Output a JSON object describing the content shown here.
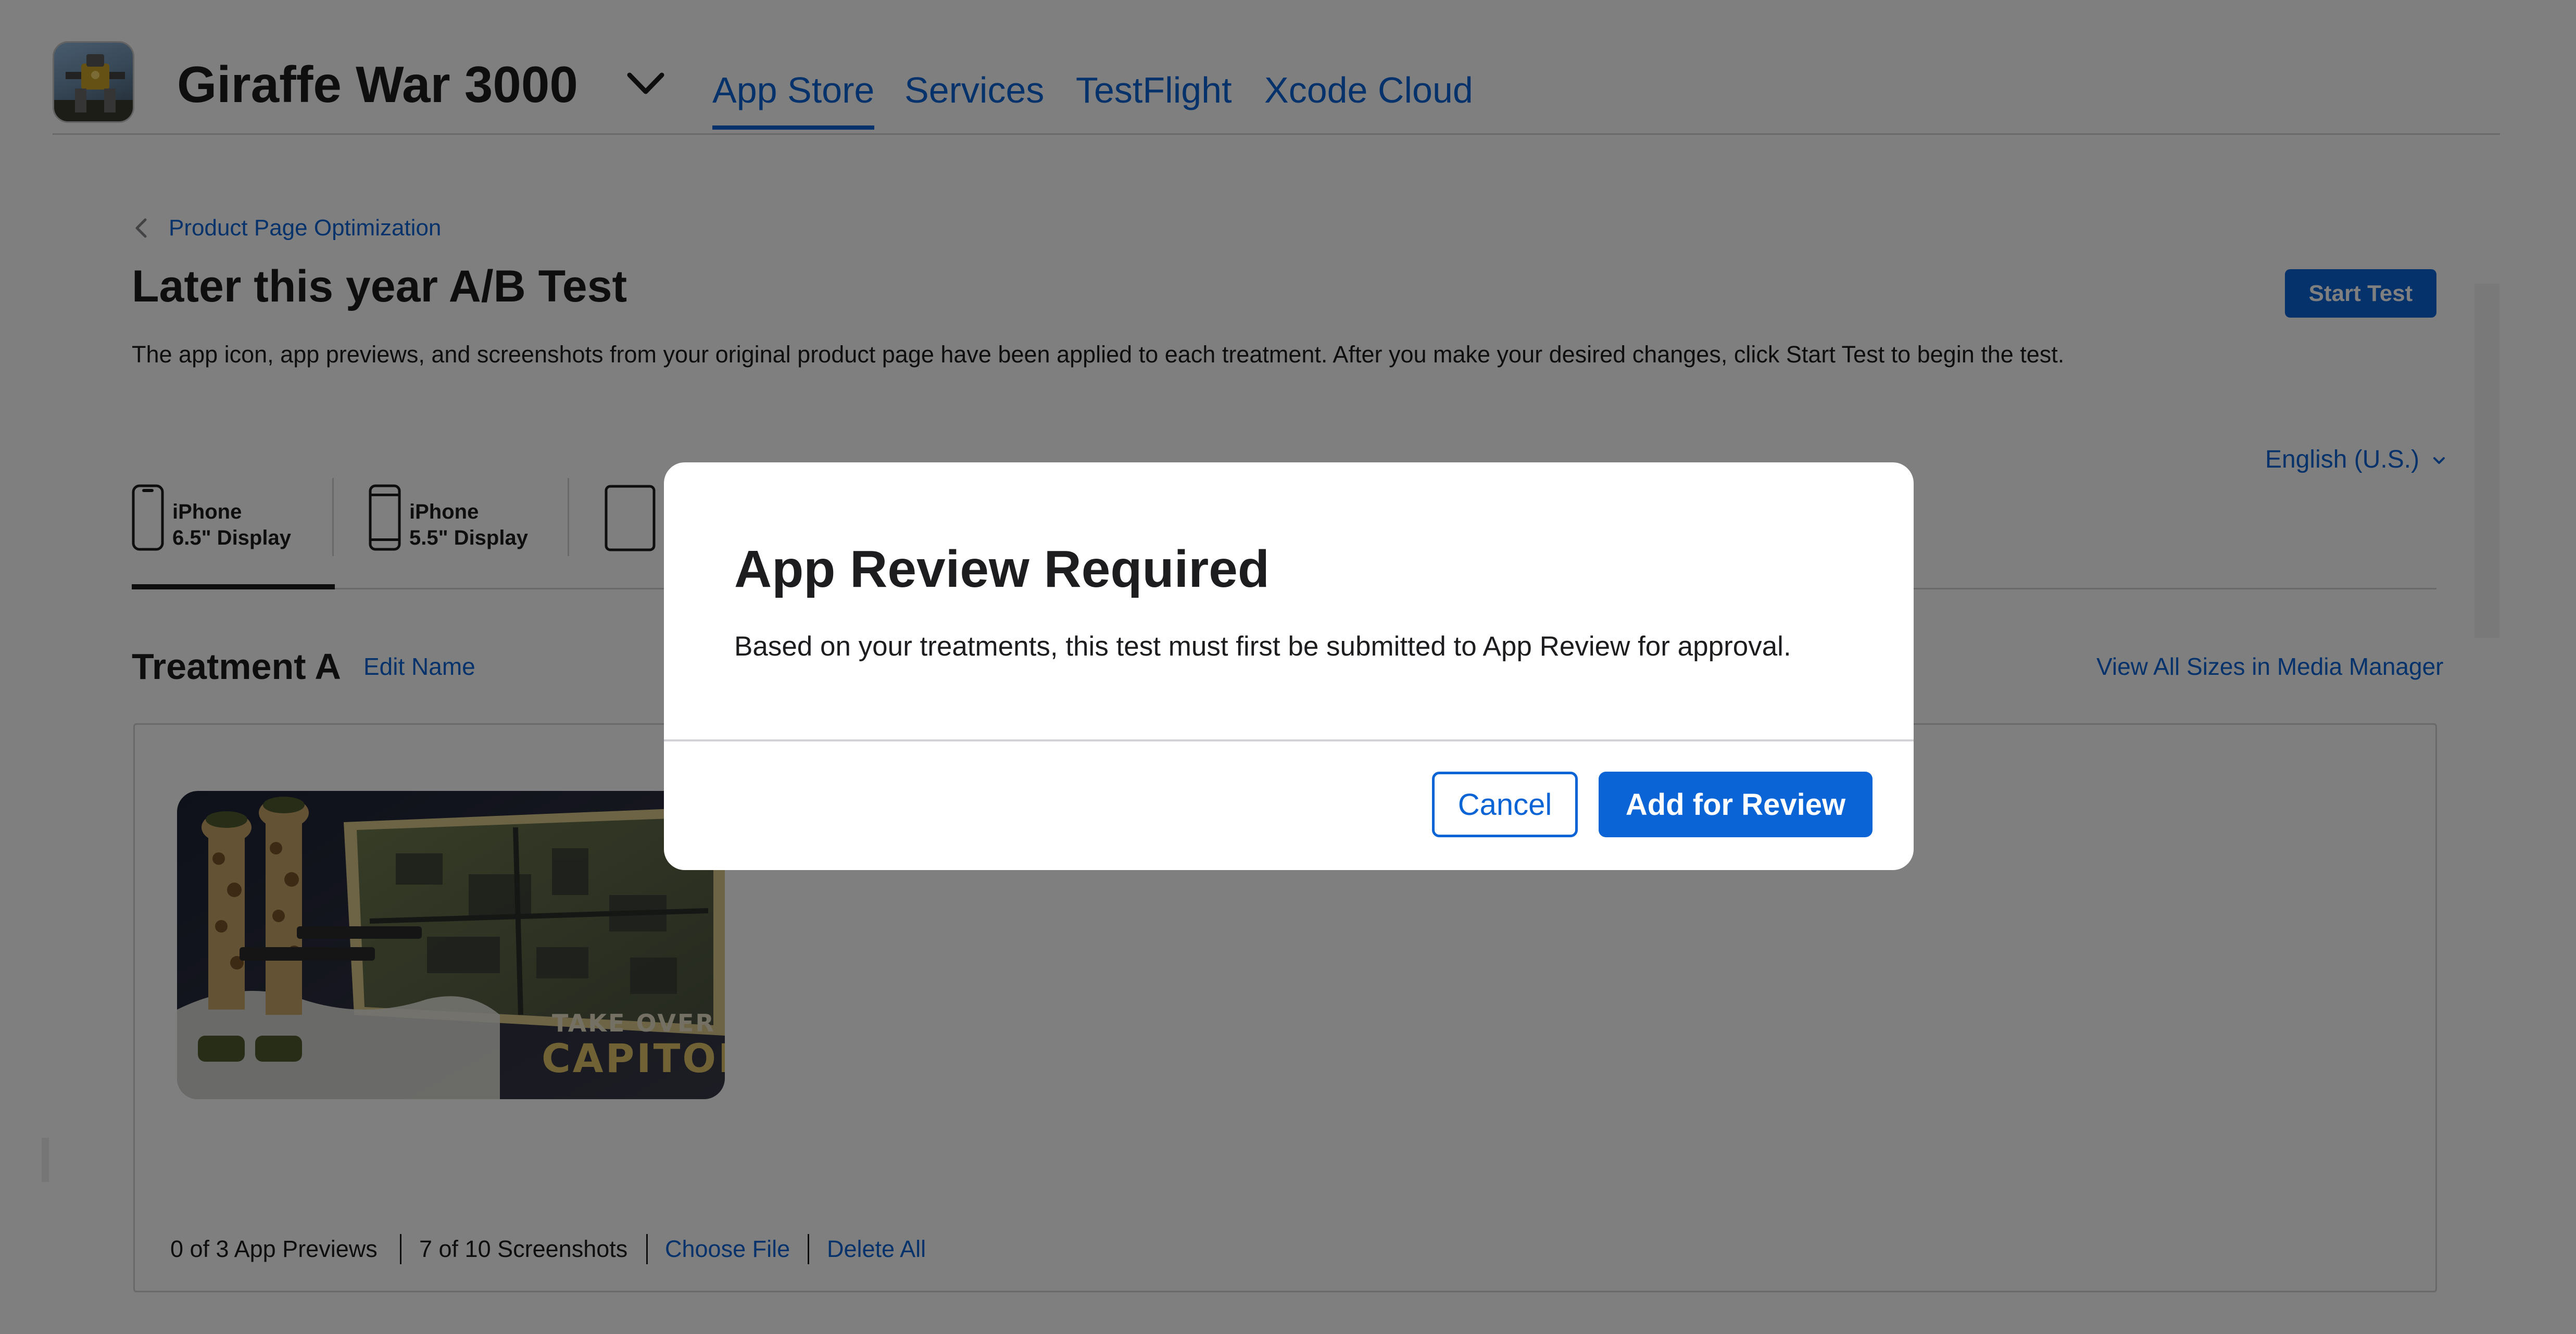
{
  "header": {
    "app_name": "Giraffe War 3000",
    "tabs": [
      {
        "label": "App Store",
        "active": true
      },
      {
        "label": "Services",
        "active": false
      },
      {
        "label": "TestFlight",
        "active": false
      },
      {
        "label": "Xcode Cloud",
        "active": false
      }
    ]
  },
  "page": {
    "breadcrumb": "Product Page Optimization",
    "title": "Later this year A/B Test",
    "start_test_label": "Start Test",
    "description": "The app icon, app previews, and screenshots from your original product page have been applied to each treatment. After you make your desired changes, click Start Test to begin the test.",
    "language": "English (U.S.)",
    "device_tabs": [
      {
        "line1": "iPhone",
        "line2": "6.5\" Display",
        "selected": true
      },
      {
        "line1": "iPhone",
        "line2": "5.5\" Display",
        "selected": false
      }
    ]
  },
  "treatment": {
    "name": "Treatment A",
    "edit_name_label": "Edit Name",
    "view_all_label": "View All Sizes in Media Manager",
    "screenshot_text_line1": "TAKE OVER THE",
    "screenshot_text_line2": "CAPITOL",
    "footer": {
      "previews": "0 of 3 App Previews",
      "screenshots": "7 of 10 Screenshots",
      "choose_file": "Choose File",
      "delete_all": "Delete All"
    }
  },
  "modal": {
    "title": "App Review Required",
    "body": "Based on your treatments, this test must first be submitted to App Review for approval.",
    "cancel_label": "Cancel",
    "confirm_label": "Add for Review"
  },
  "colors": {
    "accent": "#0a64d6",
    "overlay": "rgba(0,0,0,0.5)",
    "text": "#1d1d1f"
  },
  "icons": [
    "app-icon",
    "chevron-down-icon",
    "chevron-left-icon",
    "iphone-6-5-icon",
    "iphone-5-5-icon",
    "ipad-icon"
  ]
}
